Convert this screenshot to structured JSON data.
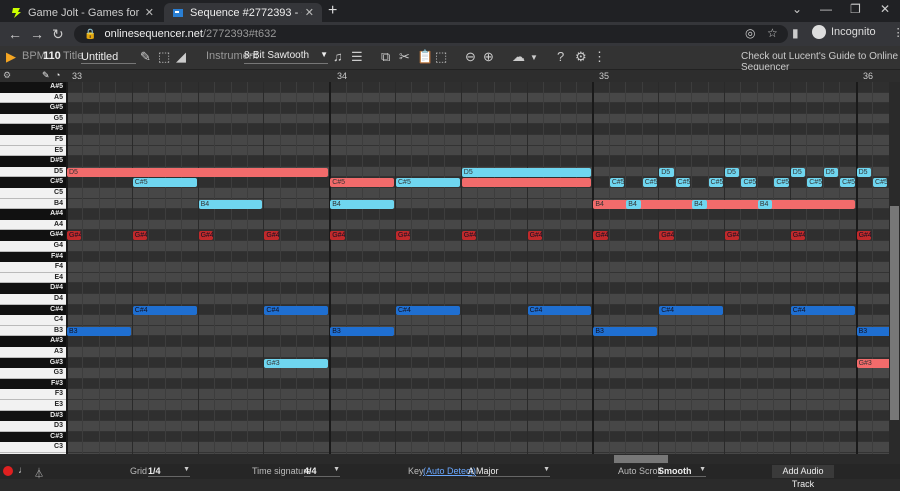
{
  "browser": {
    "tabs": [
      {
        "title": "Game Jolt - Games for the love o",
        "active": false
      },
      {
        "title": "Sequence #2772393 - Online Seq",
        "active": true
      }
    ],
    "new_tab": "+",
    "url_host": "onlinesequencer.net",
    "url_path": "/2772393#t632",
    "incognito_label": "Incognito"
  },
  "toolbar": {
    "bpm_label": "BPM",
    "bpm_value": "110",
    "title_label": "Title",
    "title_value": "Untitled",
    "instrument_label": "Instrument",
    "instrument_value": "8-Bit Sawtooth",
    "guide_text": "Check out Lucent's Guide to Online Sequencer"
  },
  "ruler": {
    "bars": [
      "33",
      "34",
      "35",
      "36"
    ]
  },
  "keys": [
    "A#5",
    "A5",
    "G#5",
    "G5",
    "F#5",
    "F5",
    "E5",
    "D#5",
    "D5",
    "C#5",
    "C5",
    "B4",
    "A#4",
    "A4",
    "G#4",
    "G4",
    "F#4",
    "F4",
    "E4",
    "D#4",
    "D4",
    "C#4",
    "C4",
    "B3",
    "A#3",
    "A3",
    "G#3",
    "G3",
    "F#3",
    "F3",
    "E3",
    "D#3",
    "D3",
    "C#3",
    "C3",
    "B2"
  ],
  "notes": [
    {
      "pitch": "D5",
      "start": 0,
      "len": 16,
      "color": "#f26b6b",
      "label": "D5"
    },
    {
      "pitch": "D5",
      "start": 24,
      "len": 8,
      "color": "#6fd6f0",
      "label": "D5"
    },
    {
      "pitch": "D5",
      "start": 36,
      "len": 1,
      "color": "#6fd6f0",
      "label": "D5"
    },
    {
      "pitch": "D5",
      "start": 40,
      "len": 1,
      "color": "#6fd6f0",
      "label": "D5"
    },
    {
      "pitch": "D5",
      "start": 44,
      "len": 1,
      "color": "#6fd6f0",
      "label": "D5"
    },
    {
      "pitch": "D5",
      "start": 46,
      "len": 1,
      "color": "#6fd6f0",
      "label": "D5"
    },
    {
      "pitch": "D5",
      "start": 48,
      "len": 1,
      "color": "#6fd6f0",
      "label": "D5"
    },
    {
      "pitch": "C#5",
      "start": 4,
      "len": 4,
      "color": "#6fd6f0",
      "label": "C#5"
    },
    {
      "pitch": "C#5",
      "start": 16,
      "len": 4,
      "color": "#f26b6b",
      "label": "C#5"
    },
    {
      "pitch": "C#5",
      "start": 20,
      "len": 4,
      "color": "#6fd6f0",
      "label": "C#5"
    },
    {
      "pitch": "C#5",
      "start": 24,
      "len": 8,
      "color": "#f26b6b",
      "label": ""
    },
    {
      "pitch": "C#5",
      "start": 33,
      "len": 1,
      "color": "#6fd6f0",
      "label": "C#5"
    },
    {
      "pitch": "C#5",
      "start": 35,
      "len": 1,
      "color": "#6fd6f0",
      "label": "C#5"
    },
    {
      "pitch": "C#5",
      "start": 37,
      "len": 1,
      "color": "#6fd6f0",
      "label": "C#5"
    },
    {
      "pitch": "C#5",
      "start": 39,
      "len": 1,
      "color": "#6fd6f0",
      "label": "C#5"
    },
    {
      "pitch": "C#5",
      "start": 41,
      "len": 1,
      "color": "#6fd6f0",
      "label": "C#5"
    },
    {
      "pitch": "C#5",
      "start": 43,
      "len": 1,
      "color": "#6fd6f0",
      "label": "C#5"
    },
    {
      "pitch": "C#5",
      "start": 45,
      "len": 1,
      "color": "#6fd6f0",
      "label": "C#5"
    },
    {
      "pitch": "C#5",
      "start": 47,
      "len": 1,
      "color": "#6fd6f0",
      "label": "C#5"
    },
    {
      "pitch": "C#5",
      "start": 49,
      "len": 1,
      "color": "#6fd6f0",
      "label": "C#5"
    },
    {
      "pitch": "B4",
      "start": 8,
      "len": 4,
      "color": "#6fd6f0",
      "label": "B4"
    },
    {
      "pitch": "B4",
      "start": 16,
      "len": 4,
      "color": "#6fd6f0",
      "label": "B4"
    },
    {
      "pitch": "B4",
      "start": 32,
      "len": 16,
      "color": "#f26b6b",
      "label": "B4"
    },
    {
      "pitch": "B4",
      "start": 34,
      "len": 1,
      "color": "#6fd6f0",
      "label": "B4"
    },
    {
      "pitch": "B4",
      "start": 38,
      "len": 1,
      "color": "#6fd6f0",
      "label": "B4"
    },
    {
      "pitch": "B4",
      "start": 42,
      "len": 1,
      "color": "#6fd6f0",
      "label": "B4"
    },
    {
      "pitch": "G#4",
      "start": 0,
      "len": 1,
      "color": "#c0292b",
      "label": "G#4"
    },
    {
      "pitch": "G#4",
      "start": 4,
      "len": 1,
      "color": "#c0292b",
      "label": "G#4"
    },
    {
      "pitch": "G#4",
      "start": 8,
      "len": 1,
      "color": "#c0292b",
      "label": "G#4"
    },
    {
      "pitch": "G#4",
      "start": 12,
      "len": 1,
      "color": "#c0292b",
      "label": "G#4"
    },
    {
      "pitch": "G#4",
      "start": 16,
      "len": 1,
      "color": "#c0292b",
      "label": "G#4"
    },
    {
      "pitch": "G#4",
      "start": 20,
      "len": 1,
      "color": "#c0292b",
      "label": "G#4"
    },
    {
      "pitch": "G#4",
      "start": 24,
      "len": 1,
      "color": "#c0292b",
      "label": "G#4"
    },
    {
      "pitch": "G#4",
      "start": 28,
      "len": 1,
      "color": "#c0292b",
      "label": "G#4"
    },
    {
      "pitch": "G#4",
      "start": 32,
      "len": 1,
      "color": "#c0292b",
      "label": "G#4"
    },
    {
      "pitch": "G#4",
      "start": 36,
      "len": 1,
      "color": "#c0292b",
      "label": "G#4"
    },
    {
      "pitch": "G#4",
      "start": 40,
      "len": 1,
      "color": "#c0292b",
      "label": "G#4"
    },
    {
      "pitch": "G#4",
      "start": 44,
      "len": 1,
      "color": "#c0292b",
      "label": "G#4"
    },
    {
      "pitch": "G#4",
      "start": 48,
      "len": 1,
      "color": "#c0292b",
      "label": "G#4"
    },
    {
      "pitch": "C#4",
      "start": 4,
      "len": 4,
      "color": "#1f6fd1",
      "label": "C#4"
    },
    {
      "pitch": "C#4",
      "start": 12,
      "len": 4,
      "color": "#1f6fd1",
      "label": "C#4"
    },
    {
      "pitch": "C#4",
      "start": 20,
      "len": 4,
      "color": "#1f6fd1",
      "label": "C#4"
    },
    {
      "pitch": "C#4",
      "start": 28,
      "len": 4,
      "color": "#1f6fd1",
      "label": "C#4"
    },
    {
      "pitch": "C#4",
      "start": 36,
      "len": 4,
      "color": "#1f6fd1",
      "label": "C#4"
    },
    {
      "pitch": "C#4",
      "start": 44,
      "len": 4,
      "color": "#1f6fd1",
      "label": "C#4"
    },
    {
      "pitch": "B3",
      "start": 0,
      "len": 4,
      "color": "#1f6fd1",
      "label": "B3"
    },
    {
      "pitch": "B3",
      "start": 16,
      "len": 4,
      "color": "#1f6fd1",
      "label": "B3"
    },
    {
      "pitch": "B3",
      "start": 32,
      "len": 4,
      "color": "#1f6fd1",
      "label": "B3"
    },
    {
      "pitch": "B3",
      "start": 48,
      "len": 3,
      "color": "#1f6fd1",
      "label": "B3"
    },
    {
      "pitch": "G#3",
      "start": 12,
      "len": 4,
      "color": "#6fd6f0",
      "label": "G#3"
    },
    {
      "pitch": "G#3",
      "start": 48,
      "len": 3,
      "color": "#f26b6b",
      "label": "G#3"
    }
  ],
  "footer": {
    "grid_label": "Grid",
    "grid_value": "1/4",
    "timesig_label": "Time signature",
    "timesig_value": "4/4",
    "key_label": "Key",
    "key_auto": "(Auto Detect)",
    "key_value": "A Major",
    "autoscroll_label": "Auto Scroll",
    "autoscroll_value": "Smooth",
    "add_audio": "Add Audio Track"
  }
}
